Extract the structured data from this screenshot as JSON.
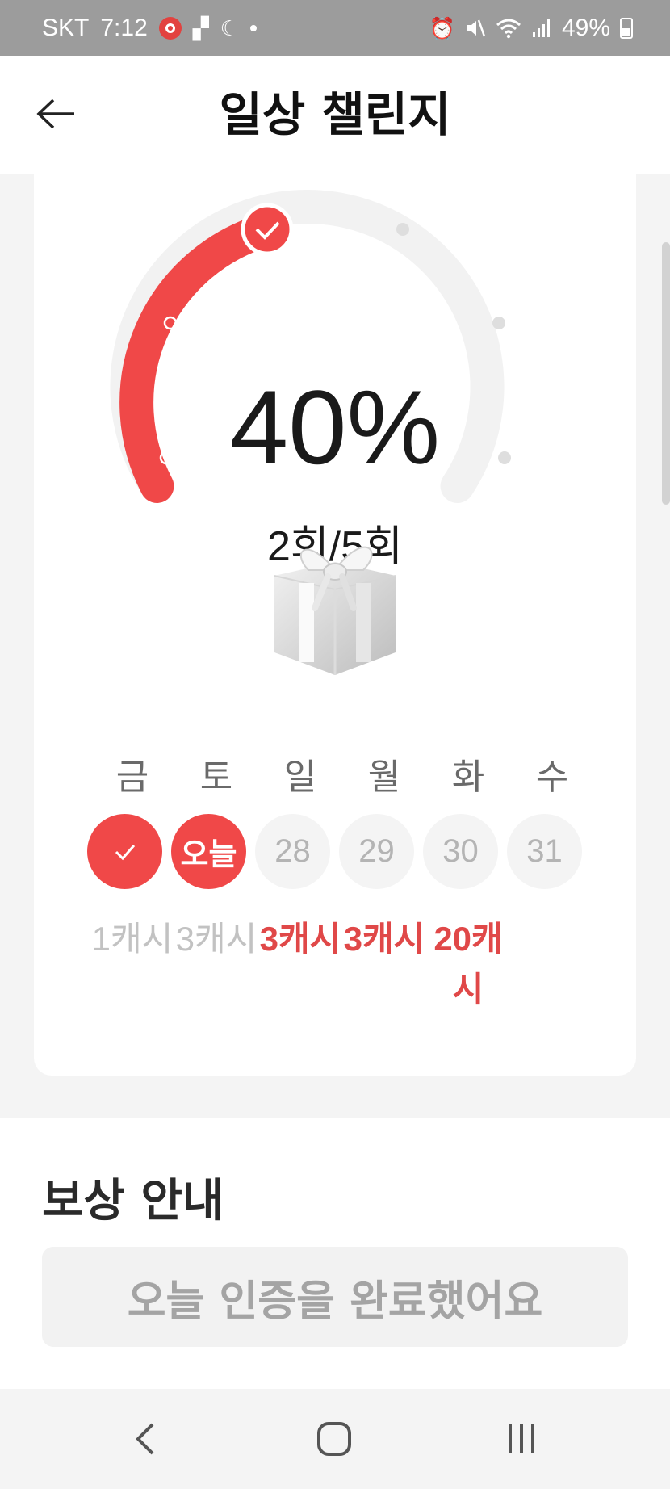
{
  "status_bar": {
    "carrier": "SKT",
    "time": "7:12",
    "battery": "49%",
    "icons": [
      "camera-badge-icon",
      "photo-icon",
      "moon-icon",
      "dot-icon",
      "alarm-icon",
      "mute-icon",
      "wifi-icon",
      "signal-icon",
      "battery-icon"
    ]
  },
  "header": {
    "title": "일상 챌린지",
    "back_icon": "arrow-left-icon"
  },
  "challenge": {
    "progress_percent": "40%",
    "progress_fraction": 0.4,
    "count_text": "2회/5회",
    "checkpoints": 5,
    "completed": 2,
    "days": [
      {
        "name": "금",
        "label": "",
        "reward": "1캐시",
        "state": "done"
      },
      {
        "name": "토",
        "label": "오늘",
        "reward": "3캐시",
        "state": "today"
      },
      {
        "name": "일",
        "label": "28",
        "reward": "3캐시",
        "state": "upcoming"
      },
      {
        "name": "월",
        "label": "29",
        "reward": "3캐시",
        "state": "upcoming"
      },
      {
        "name": "화",
        "label": "30",
        "reward": "20캐시",
        "state": "upcoming"
      },
      {
        "name": "수",
        "label": "31",
        "reward": "",
        "state": "future"
      }
    ],
    "colors": {
      "accent": "#f04848",
      "track": "#f2f2f2"
    }
  },
  "reward_guide": {
    "title": "보상 안내",
    "button_label": "오늘 인증을 완료했어요"
  },
  "nav": {
    "icons": [
      "nav-back-icon",
      "nav-home-icon",
      "nav-recents-icon"
    ]
  }
}
